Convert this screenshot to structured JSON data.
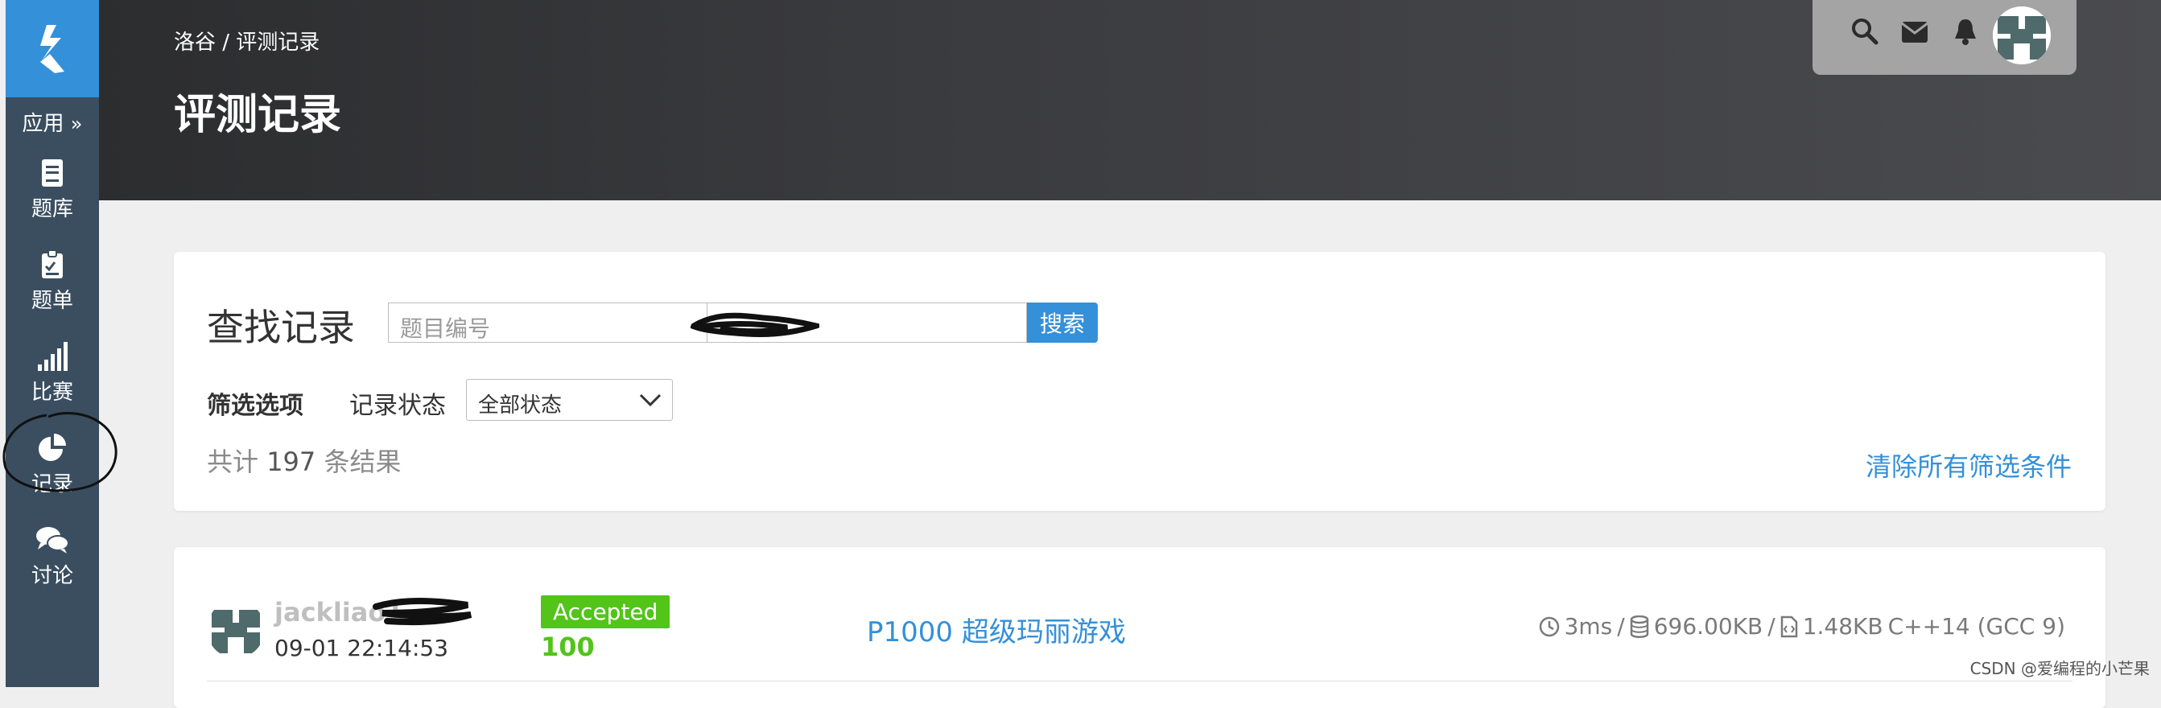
{
  "sidebar": {
    "apps_label": "应用",
    "items": [
      {
        "label": "题库",
        "icon": "book-icon"
      },
      {
        "label": "题单",
        "icon": "clipboard-icon"
      },
      {
        "label": "比赛",
        "icon": "signal-bars-icon"
      },
      {
        "label": "记录",
        "icon": "pie-chart-icon"
      },
      {
        "label": "讨论",
        "icon": "comments-icon"
      }
    ]
  },
  "header": {
    "breadcrumb": "洛谷 / 评测记录",
    "title": "评测记录",
    "icons": [
      "search-icon",
      "envelope-icon",
      "bell-icon"
    ]
  },
  "search": {
    "title": "查找记录",
    "placeholder": "题目编号",
    "button": "搜索"
  },
  "filters": {
    "label": "筛选选项",
    "status_label": "记录状态",
    "status_value": "全部状态",
    "count_prefix": "共计",
    "count": "197",
    "count_suffix": "条结果",
    "clear_link": "清除所有筛选条件"
  },
  "record": {
    "username": "jackliao1",
    "time": "09-01 22:14:53",
    "status": "Accepted",
    "score": "100",
    "problem": "P1000 超级玛丽游戏",
    "runtime": "3ms",
    "memory": "696.00KB",
    "code_size": "1.48KB",
    "language": "C++14 (GCC 9)"
  },
  "watermark": "CSDN @爱编程的小芒果",
  "colors": {
    "accent": "#3490d8",
    "sidebar": "#3a4e60",
    "accepted": "#52c41a"
  }
}
